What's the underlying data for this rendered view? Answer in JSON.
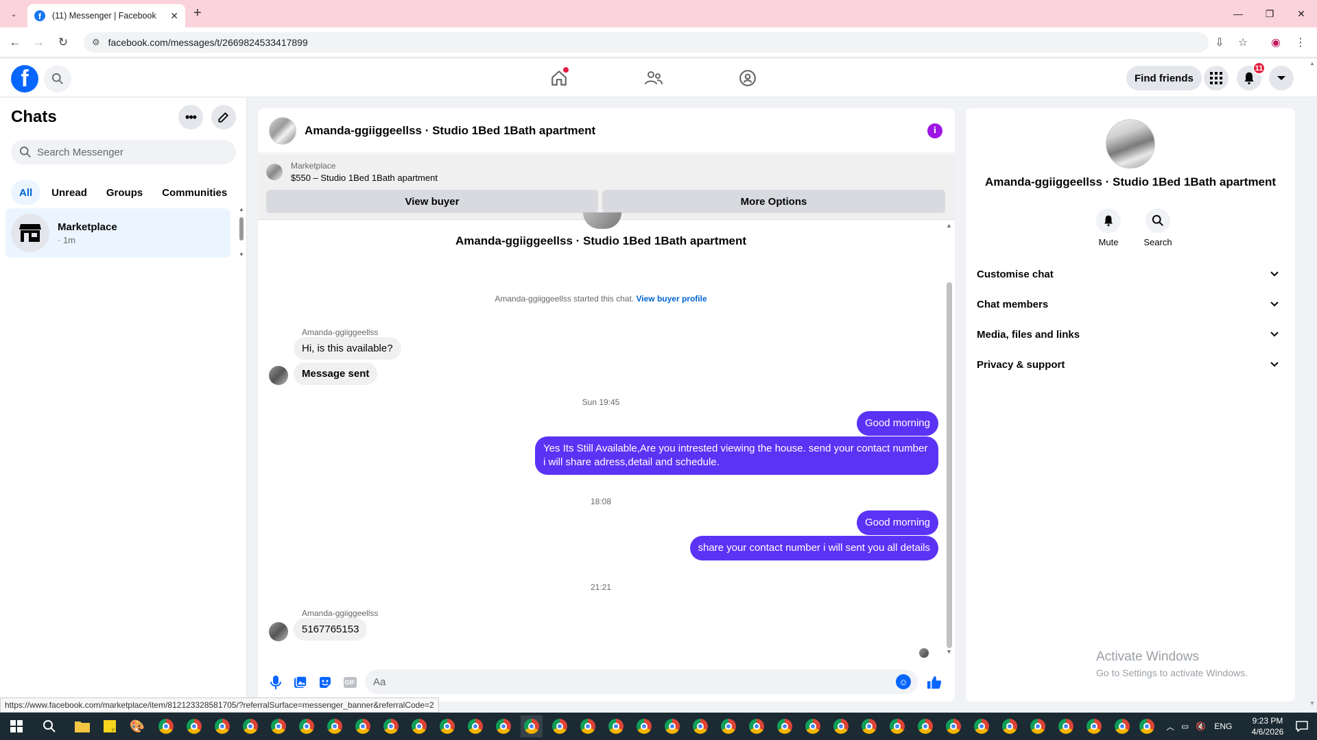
{
  "browser": {
    "tab_title": "(11) Messenger | Facebook",
    "url": "facebook.com/messages/t/2669824533417899",
    "status_url": "https://www.facebook.com/marketplace/item/812123328581705/?referralSurface=messenger_banner&referralCode=2"
  },
  "header": {
    "find_friends": "Find friends",
    "notification_count": "11"
  },
  "sidebar": {
    "title": "Chats",
    "search_placeholder": "Search Messenger",
    "filters": [
      "All",
      "Unread",
      "Groups",
      "Communities"
    ],
    "active_filter": "All",
    "chats": [
      {
        "name": "Marketplace",
        "time": "· 1m"
      }
    ]
  },
  "conversation": {
    "title": "Amanda-ggiiggeellss · Studio 1Bed 1Bath apartment",
    "marketplace_label": "Marketplace",
    "listing": "$550 – Studio 1Bed 1Bath apartment",
    "view_buyer": "View buyer",
    "more_options": "More Options",
    "started_text": "Amanda-ggiiggeellss started this chat.",
    "view_buyer_profile": "View buyer profile",
    "messages": [
      {
        "sender": "Amanda-ggiiggeellss",
        "text": "Hi, is this available?",
        "direction": "in"
      },
      {
        "text": "Message sent",
        "direction": "in"
      },
      {
        "stamp": "Sun 19:45"
      },
      {
        "text": "Good morning",
        "direction": "out"
      },
      {
        "text": "Yes Its Still Available,Are you intrested viewing the house. send your contact number i will share adress,detail and schedule.",
        "direction": "out"
      },
      {
        "stamp": "18:08"
      },
      {
        "text": "Good morning",
        "direction": "out"
      },
      {
        "text": "share your contact number i will sent you all details",
        "direction": "out"
      },
      {
        "stamp": "21:21"
      },
      {
        "sender": "Amanda-ggiiggeellss",
        "text": "5167765153",
        "direction": "in"
      }
    ],
    "composer_placeholder": "Aa"
  },
  "details": {
    "title": "Amanda-ggiiggeellss · Studio 1Bed 1Bath apartment",
    "actions": [
      "Mute",
      "Search"
    ],
    "sections": [
      "Customise chat",
      "Chat members",
      "Media, files and links",
      "Privacy & support"
    ],
    "watermark_title": "Activate Windows",
    "watermark_sub": "Go to Settings to activate Windows."
  },
  "taskbar": {
    "language": "ENG",
    "time": "9:23 PM",
    "date": "4/6/2026"
  },
  "colors": {
    "accent": "#0866ff",
    "outgoing_bubble": "#5b33f5",
    "tab_bar": "#fbd3dc"
  }
}
